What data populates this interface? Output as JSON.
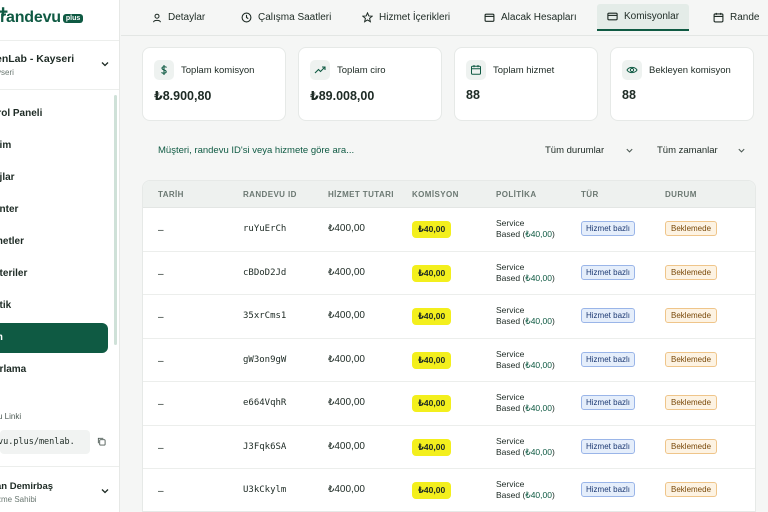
{
  "sidebar": {
    "logo_text": "randevu",
    "logo_badge": "plus",
    "business_name": "enLab - Kayseri",
    "business_city": "yseri",
    "nav": [
      {
        "label": "trol Paneli"
      },
      {
        "label": "vim"
      },
      {
        "label": "ajlar"
      },
      {
        "label": "anter"
      },
      {
        "label": "metler"
      },
      {
        "label": "şteriler"
      },
      {
        "label": "litik"
      },
      {
        "label": "m"
      },
      {
        "label": "arlama"
      }
    ],
    "link_label": "u Linki",
    "link_value": "vu.plus/menlab.",
    "user_name": "an Demirbaş",
    "user_role": "zme Sahibi"
  },
  "tabs": [
    {
      "label": "Detaylar",
      "icon": "user-icon"
    },
    {
      "label": "Çalışma Saatleri",
      "icon": "clock-icon"
    },
    {
      "label": "Hizmet İçerikleri",
      "icon": "star-icon"
    },
    {
      "label": "Alacak Hesapları",
      "icon": "wallet-icon"
    },
    {
      "label": "Komisyonlar",
      "icon": "card-icon"
    },
    {
      "label": "Rande",
      "icon": "calendar-icon"
    }
  ],
  "stats": [
    {
      "label": "Toplam komisyon",
      "value": "₺8.900,80",
      "icon": "dollar-icon"
    },
    {
      "label": "Toplam ciro",
      "value": "₺89.008,00",
      "icon": "trending-up-icon"
    },
    {
      "label": "Toplam hizmet",
      "value": "88",
      "icon": "calendar-icon"
    },
    {
      "label": "Bekleyen komisyon",
      "value": "88",
      "icon": "eye-icon"
    }
  ],
  "filters": {
    "search_placeholder": "Müşteri, randevu ID'si veya hizmete göre ara...",
    "status_label": "Tüm durumlar",
    "time_label": "Tüm zamanlar"
  },
  "table": {
    "headers": [
      "TARİH",
      "RANDEVU ID",
      "HİZMET TUTARI",
      "KOMİSYON",
      "POLİTİKA",
      "TÜR",
      "DURUM"
    ],
    "rows": [
      {
        "date": "–",
        "id": "ruYuErCh",
        "amount": "₺400,00",
        "commission": "₺40,00",
        "policy1": "Service",
        "policy2_prefix": "Based (",
        "policy2_value": "₺40,00",
        "policy2_suffix": ")",
        "type": "Hizmet bazlı",
        "status": "Beklemede"
      },
      {
        "date": "–",
        "id": "cBDoD2Jd",
        "amount": "₺400,00",
        "commission": "₺40,00",
        "policy1": "Service",
        "policy2_prefix": "Based (",
        "policy2_value": "₺40,00",
        "policy2_suffix": ")",
        "type": "Hizmet bazlı",
        "status": "Beklemede"
      },
      {
        "date": "–",
        "id": "35xrCms1",
        "amount": "₺400,00",
        "commission": "₺40,00",
        "policy1": "Service",
        "policy2_prefix": "Based (",
        "policy2_value": "₺40,00",
        "policy2_suffix": ")",
        "type": "Hizmet bazlı",
        "status": "Beklemede"
      },
      {
        "date": "–",
        "id": "gW3on9gW",
        "amount": "₺400,00",
        "commission": "₺40,00",
        "policy1": "Service",
        "policy2_prefix": "Based (",
        "policy2_value": "₺40,00",
        "policy2_suffix": ")",
        "type": "Hizmet bazlı",
        "status": "Beklemede"
      },
      {
        "date": "–",
        "id": "e664VqhR",
        "amount": "₺400,00",
        "commission": "₺40,00",
        "policy1": "Service",
        "policy2_prefix": "Based (",
        "policy2_value": "₺40,00",
        "policy2_suffix": ")",
        "type": "Hizmet bazlı",
        "status": "Beklemede"
      },
      {
        "date": "–",
        "id": "J3Fqk6SA",
        "amount": "₺400,00",
        "commission": "₺40,00",
        "policy1": "Service",
        "policy2_prefix": "Based (",
        "policy2_value": "₺40,00",
        "policy2_suffix": ")",
        "type": "Hizmet bazlı",
        "status": "Beklemede"
      },
      {
        "date": "–",
        "id": "U3kCkylm",
        "amount": "₺400,00",
        "commission": "₺40,00",
        "policy1": "Service",
        "policy2_prefix": "Based (",
        "policy2_value": "₺40,00",
        "policy2_suffix": ")",
        "type": "Hizmet bazlı",
        "status": "Beklemede"
      }
    ]
  },
  "colors": {
    "brand": "#0f5a43",
    "commission_highlight": "#f3ef1d",
    "type_badge": "#e5eefb",
    "status_badge": "#fdf3e3"
  }
}
